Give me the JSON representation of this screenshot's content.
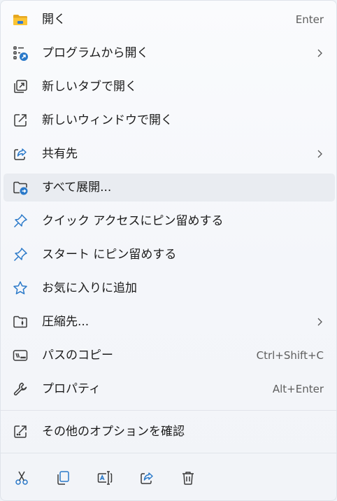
{
  "colors": {
    "accent": "#2a79c9",
    "icon_outline": "#3a3a3a",
    "text": "#1b1b1b",
    "secondary_text": "#5e5e5e",
    "highlight": "#e9ecf1"
  },
  "menu": {
    "items": [
      {
        "label": "開く",
        "shortcut": "Enter",
        "icon": "folder-icon"
      },
      {
        "label": "プログラムから開く",
        "icon": "open-with-icon",
        "submenu": true
      },
      {
        "label": "新しいタブで開く",
        "icon": "new-tab-icon"
      },
      {
        "label": "新しいウィンドウで開く",
        "icon": "new-window-icon"
      },
      {
        "label": "共有先",
        "icon": "share-icon",
        "submenu": true
      },
      {
        "label": "すべて展開...",
        "icon": "extract-icon",
        "highlighted": true
      },
      {
        "label": "クイック アクセスにピン留めする",
        "icon": "pin-icon"
      },
      {
        "label": "スタート にピン留めする",
        "icon": "pin-icon"
      },
      {
        "label": "お気に入りに追加",
        "icon": "star-icon"
      },
      {
        "label": "圧縮先...",
        "icon": "zip-folder-icon",
        "submenu": true
      },
      {
        "label": "パスのコピー",
        "shortcut": "Ctrl+Shift+C",
        "icon": "copy-path-icon"
      },
      {
        "label": "プロパティ",
        "shortcut": "Alt+Enter",
        "icon": "wrench-icon"
      }
    ],
    "more_options": {
      "label": "その他のオプションを確認",
      "icon": "more-options-icon"
    }
  },
  "toolbar": {
    "buttons": [
      {
        "name": "cut",
        "icon": "scissors-icon"
      },
      {
        "name": "copy",
        "icon": "copy-icon"
      },
      {
        "name": "rename",
        "icon": "rename-icon"
      },
      {
        "name": "share",
        "icon": "share-icon"
      },
      {
        "name": "delete",
        "icon": "trash-icon"
      }
    ]
  }
}
